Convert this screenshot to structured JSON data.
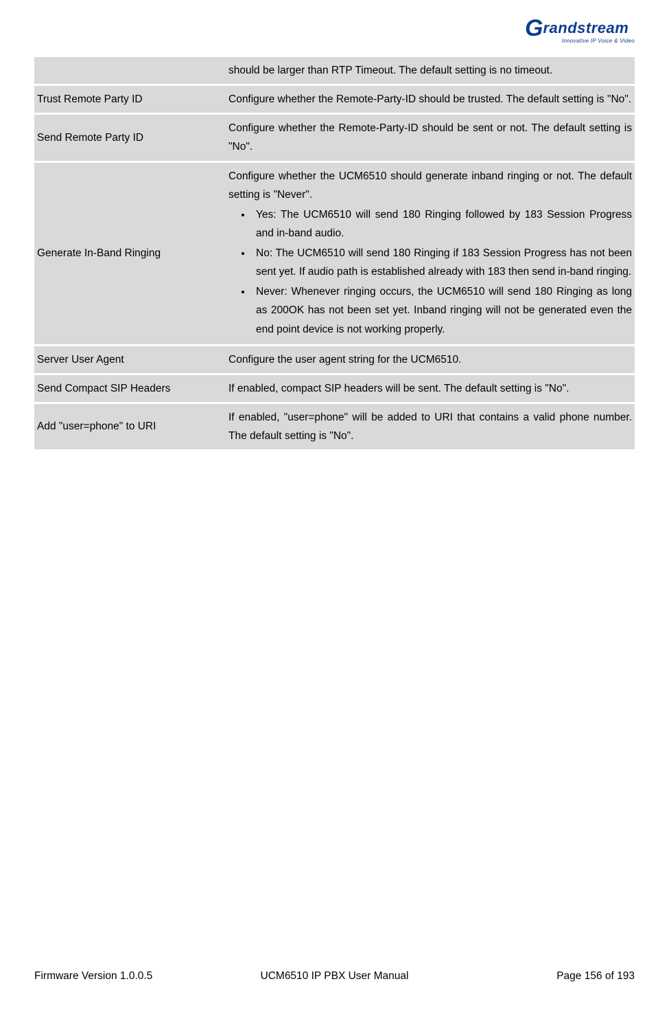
{
  "logo": {
    "brand_g": "G",
    "brand_rest": "randstream",
    "tagline": "Innovative IP Voice & Video"
  },
  "rows": [
    {
      "label": "",
      "desc_plain": "should be larger than RTP Timeout. The default setting is no timeout."
    },
    {
      "label": "Trust Remote Party ID",
      "desc_plain": "Configure whether the Remote-Party-ID should be trusted. The default setting is \"No\"."
    },
    {
      "label": "Send Remote Party ID",
      "desc_plain": "Configure whether the Remote-Party-ID should be sent or not. The default setting is \"No\"."
    },
    {
      "label": "Generate In-Band Ringing",
      "desc_intro": "Configure whether the UCM6510 should generate inband ringing or not. The default setting is \"Never\".",
      "bullets": [
        "Yes: The UCM6510 will send 180 Ringing followed by 183 Session Progress and in-band audio.",
        "No: The UCM6510 will send 180 Ringing if 183 Session Progress has not been sent yet. If audio path is established already with 183 then send in-band ringing.",
        "Never: Whenever ringing occurs, the UCM6510 will send 180 Ringing as long as 200OK has not been set yet. Inband ringing will not be generated even the end point device is not working properly."
      ]
    },
    {
      "label": "Server User Agent",
      "desc_plain": "Configure the user agent string for the UCM6510."
    },
    {
      "label": "Send Compact SIP Headers",
      "desc_plain": "If enabled, compact SIP headers will be sent. The default setting is \"No\"."
    },
    {
      "label": "Add \"user=phone\" to URI",
      "desc_plain": "If enabled, \"user=phone\" will be added to URI that contains a valid phone number. The default setting is \"No\"."
    }
  ],
  "footer": {
    "left": "Firmware Version 1.0.0.5",
    "center": "UCM6510 IP PBX User Manual",
    "right": "Page 156 of 193"
  }
}
